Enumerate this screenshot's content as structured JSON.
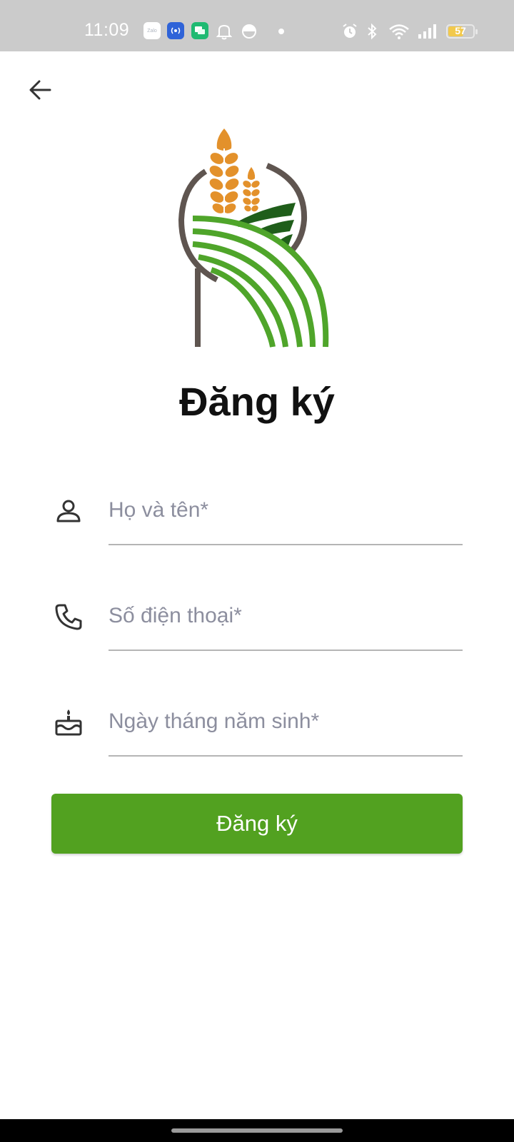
{
  "status_bar": {
    "time": "11:09",
    "battery": "57",
    "battery_level": 0.57,
    "icons": [
      "zalo-icon",
      "podcast-icon",
      "chat-icon",
      "bell-icon",
      "half-circle-icon",
      "dot-icon",
      "alarm-icon",
      "bluetooth-icon",
      "wifi-icon",
      "signal-icon",
      "battery-icon"
    ],
    "zalo_label": "Zalo"
  },
  "header": {
    "back_icon": "arrow-left-icon"
  },
  "page": {
    "title": "Đăng ký"
  },
  "form": {
    "fields": [
      {
        "label": "Họ và tên*",
        "icon": "person-icon"
      },
      {
        "label": "Số điện thoại*",
        "icon": "phone-icon"
      },
      {
        "label": "Ngày tháng năm sinh*",
        "icon": "birthday-cake-icon"
      }
    ],
    "submit_label": "Đăng ký"
  },
  "colors": {
    "primary_green": "#52a120",
    "dark_green": "#1f5e1a",
    "wheat_orange": "#e3912b",
    "logo_brown": "#5f5550",
    "placeholder_text": "#8c8e9e",
    "status_bar_bg": "#cbcbcb"
  }
}
